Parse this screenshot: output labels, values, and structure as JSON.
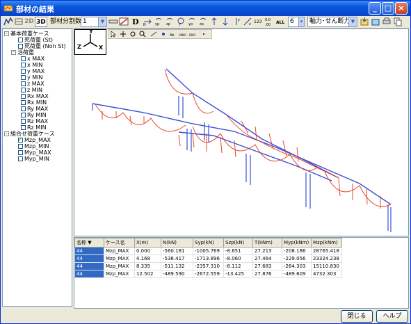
{
  "window": {
    "title": "部材の結果",
    "minimize_glyph": "_",
    "maximize_glyph": "□",
    "close_glyph": "×"
  },
  "toolbar": {
    "btn_2d": "2D",
    "btn_3d": "3D",
    "division_label": "部材分割数",
    "division_value": "1",
    "btn_d": "D",
    "count_value": "6",
    "force_select": "軸力･せん断力"
  },
  "tree": {
    "basic_group": "基本荷重ケース",
    "dead_load": "死荷重 (St)",
    "dead_load_non": "死荷重 (Non St)",
    "live_group": "活荷重",
    "live_items": [
      "x MAX",
      "x MIN",
      "y MAX",
      "y MIN",
      "z MAX",
      "z MIN",
      "Rx MAX",
      "Rx MIN",
      "Ry MAX",
      "Ry MIN",
      "Rz MAX",
      "Rz MIN"
    ],
    "combo_group": "組合せ荷重ケース",
    "combo_items": [
      "Mzp_MAX",
      "Mzp_MIN",
      "Myp_MAX",
      "Myp_MIN"
    ]
  },
  "view": {
    "axis_y": "Y",
    "axis_z": "Z",
    "axis_x": "X"
  },
  "table": {
    "headers": [
      "名称 ▼",
      "ケース名",
      "X(m)",
      "N(kN)",
      "Syp(kN)",
      "Szp(kN)",
      "T(kNm)",
      "Myp(kNm)",
      "Mzp(kNm)"
    ],
    "rows": [
      [
        "44",
        "Mzp_MAX",
        "0.000",
        "-560.181",
        "-1005.769",
        "-8.651",
        "27.213",
        "-208.186",
        "28765.418"
      ],
      [
        "44",
        "Mzp_MAX",
        "4.168",
        "-538.417",
        "-1713.896",
        "-8.060",
        "27.464",
        "-229.056",
        "23324.238"
      ],
      [
        "44",
        "Mzp_MAX",
        "8.335",
        "-511.132",
        "-2357.310",
        "-8.112",
        "27.683",
        "-264.303",
        "15110.830"
      ],
      [
        "44",
        "Mzp_MAX",
        "12.502",
        "-489.590",
        "-2672.559",
        "-13.425",
        "27.876",
        "-489.609",
        "4732.303"
      ]
    ]
  },
  "buttons": {
    "close": "閉じる",
    "help": "ヘルプ"
  },
  "colors": {
    "title_blue": "#0a55dc",
    "frame_blue": "#3b4fd6",
    "diagram_red": "#e8452a",
    "selection": "#316ac5"
  }
}
